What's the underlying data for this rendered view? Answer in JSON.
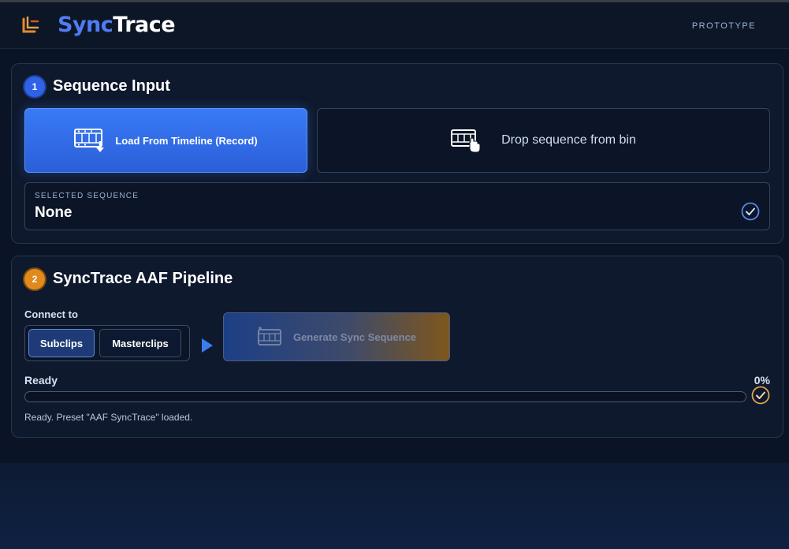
{
  "app": {
    "brand_part1": "Sync",
    "brand_part2": "Trace",
    "badge": "PROTOTYPE"
  },
  "sequence_input": {
    "step": "1",
    "title": "Sequence Input",
    "load_button": "Load From Timeline (Record)",
    "drop_button": "Drop sequence from bin",
    "selected_label": "SELECTED SEQUENCE",
    "selected_value": "None"
  },
  "pipeline": {
    "step": "2",
    "title": "SyncTrace AAF Pipeline",
    "connect_label": "Connect to",
    "options": [
      "Subclips",
      "Masterclips"
    ],
    "selected_option": "Subclips",
    "generate_button": "Generate Sync Sequence",
    "status": "Ready",
    "progress_text": "0%",
    "progress": 0,
    "message": "Ready. Preset \"AAF SyncTrace\" loaded."
  },
  "colors": {
    "accent_blue": "#2f62e6",
    "accent_orange": "#e08a1e",
    "background": "#0a1426"
  },
  "icons": [
    "logo-icon",
    "film-download-icon",
    "film-hand-icon",
    "check-circle-icon",
    "play-arrow-icon",
    "film-strip-icon"
  ]
}
